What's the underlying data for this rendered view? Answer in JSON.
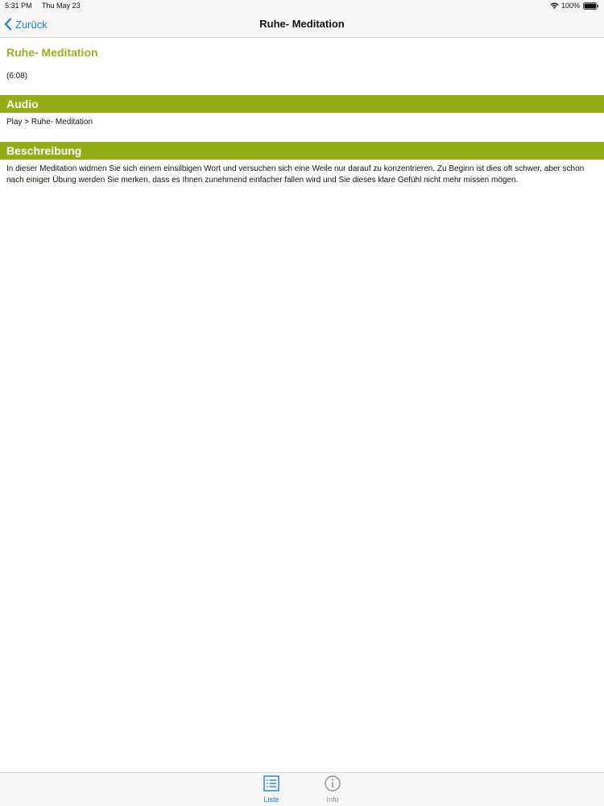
{
  "status_bar": {
    "time": "5:31 PM",
    "date": "Thu May 23",
    "battery": "100%",
    "icons": [
      "wifi-icon",
      "battery-icon"
    ]
  },
  "nav": {
    "back_label": "Zurück",
    "title": "Ruhe- Meditation",
    "back_icon": "chevron-left-icon"
  },
  "content": {
    "title": "Ruhe- Meditation",
    "duration": "(6:08)",
    "audio_header": "Audio",
    "audio_link": "Play > Ruhe- Meditation",
    "description_header": "Beschreibung",
    "description": "In dieser Meditation widmen Sie sich einem einsilbigen Wort und versuchen sich eine Weile nur darauf zu konzentrieren. Zu Beginn ist dies oft schwer, aber schon nach einiger Übung werden Sie merken, dass es Ihnen zunehmend einfacher fallen wird und Sie dieses klare Gefühl nicht mehr missen mögen."
  },
  "tab_bar": {
    "tabs": [
      {
        "label": "Liste",
        "icon": "list-icon",
        "selected": true
      },
      {
        "label": "Info",
        "icon": "info-icon",
        "selected": false
      }
    ]
  },
  "colors": {
    "accent_green": "#93ad16",
    "title_green": "#94b21e",
    "link_blue": "#1a7fd6",
    "inactive_gray": "#8e8e93"
  }
}
